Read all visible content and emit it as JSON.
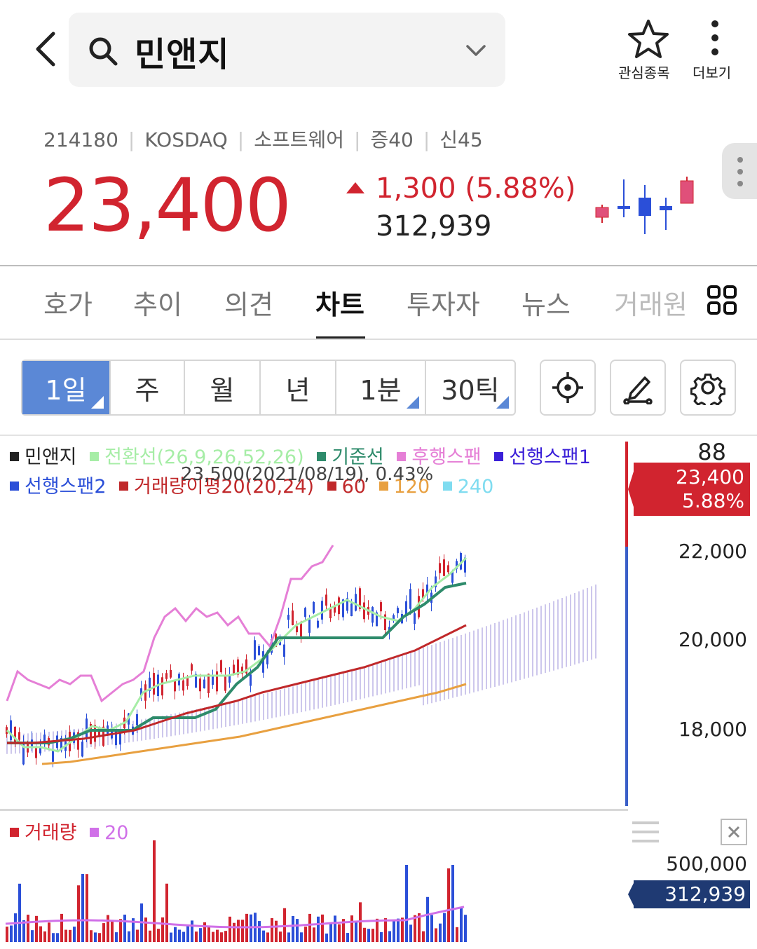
{
  "header": {
    "search_text": "민앤지",
    "watch_label": "관심종목",
    "more_label": "더보기"
  },
  "stock": {
    "code": "214180",
    "market": "KOSDAQ",
    "sector": "소프트웨어",
    "margin": "증40",
    "credit": "신45",
    "price": "23,400",
    "change": "1,300 (5.88%)",
    "volume": "312,939"
  },
  "tabs": [
    "호가",
    "추이",
    "의견",
    "차트",
    "투자자",
    "뉴스",
    "거래원"
  ],
  "periods": [
    "1일",
    "주",
    "월",
    "년",
    "1분",
    "30틱"
  ],
  "legend": {
    "name": "민앤지",
    "conversion": "전환선(26,9,26,52,26)",
    "base": "기준선",
    "lagging": "후행스팬",
    "leading1": "선행스팬1",
    "leading2": "선행스팬2",
    "ma": "거래량이평20(20,24)",
    "ma60": "60",
    "ma120": "120",
    "ma240": "240",
    "high_note": "23,500(2021/08/19), 0.43%",
    "volume_title": "거래량",
    "volume_ma": "20"
  },
  "colors": {
    "up": "#d1242f",
    "down": "#2b4fd8",
    "conversion": "#a6eda6",
    "base": "#2e8b6b",
    "lagging": "#e57fd6",
    "leading1": "#3a1fd8",
    "leading2": "#2b4fd8",
    "ma20": "#c0282a",
    "ma120": "#e8a040",
    "ma240": "#7fdcf0",
    "vol_ma": "#d070e8"
  },
  "chart_data": [
    {
      "type": "line",
      "y_axis_labels": [
        "22,000",
        "20,000",
        "18,000"
      ],
      "y_scale_top": "88",
      "current_price": "23,400",
      "current_change": "5.88%",
      "ylim": [
        16500,
        24000
      ],
      "series": [
        {
          "name": "후행스팬",
          "values": [
            19000,
            19700,
            19500,
            19400,
            19300,
            19500,
            19400,
            19600,
            19600,
            19000,
            19200,
            19400,
            19500,
            19700,
            20500,
            21000,
            21200,
            20900,
            21200,
            21000,
            21100,
            20800,
            21000,
            20600,
            20600,
            20300,
            21000,
            21900,
            21900,
            22200,
            22300,
            22700
          ]
        },
        {
          "name": "전환선",
          "values": [
            18300,
            17900,
            17900,
            17800,
            18100,
            18400,
            18300,
            18500,
            19200,
            19400,
            19500,
            19600,
            19600,
            19600,
            19700,
            20000,
            20400,
            20800,
            21000,
            21200,
            21400,
            21200,
            21000,
            20900,
            21200,
            21700,
            22000,
            22400
          ]
        },
        {
          "name": "기준선",
          "values": [
            18000,
            18000,
            18000,
            18100,
            18300,
            18300,
            18300,
            18600,
            18600,
            18600,
            18800,
            19400,
            19800,
            20500,
            20500,
            20500,
            20500,
            20500,
            20500,
            21000,
            21300,
            21700,
            21800
          ]
        },
        {
          "name": "거래량이평20",
          "values": [
            18000,
            18000,
            18050,
            18100,
            18200,
            18300,
            18500,
            18700,
            18850,
            19000,
            19200,
            19350,
            19500,
            19650,
            19800,
            20000,
            20200,
            20500,
            20800
          ]
        },
        {
          "name": "120",
          "values": [
            17500,
            17550,
            17650,
            17750,
            17850,
            17950,
            18050,
            18150,
            18300,
            18450,
            18600,
            18750,
            18900,
            19050,
            19200,
            19400
          ]
        }
      ]
    },
    {
      "type": "bar",
      "title": "거래량",
      "y_axis_labels": [
        "500,000"
      ],
      "current_volume": "312,939",
      "ylim": [
        0,
        700000
      ]
    }
  ]
}
